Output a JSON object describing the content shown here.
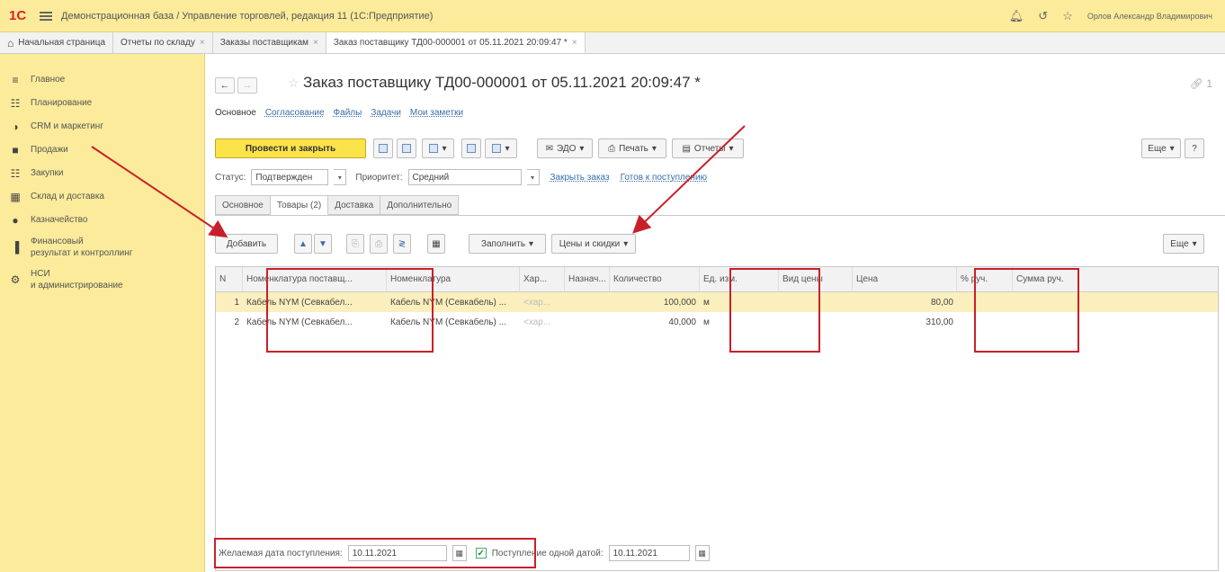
{
  "titlebar": {
    "logo": "1С",
    "title": "Демонстрационная база / Управление торговлей, редакция 11  (1С:Предприятие)",
    "user": "Орлов Александр Владимирович"
  },
  "tabs": [
    {
      "label": "Начальная страница"
    },
    {
      "label": "Отчеты по складу"
    },
    {
      "label": "Заказы поставщикам"
    },
    {
      "label": "Заказ поставщику ТД00-000001 от 05.11.2021 20:09:47 *"
    }
  ],
  "sidebar": {
    "items": [
      {
        "label": "Главное",
        "icon": "menu-icon"
      },
      {
        "label": "Планирование",
        "icon": "planning-icon"
      },
      {
        "label": "CRM и маркетинг",
        "icon": "crm-icon"
      },
      {
        "label": "Продажи",
        "icon": "sales-icon"
      },
      {
        "label": "Закупки",
        "icon": "cart-icon"
      },
      {
        "label": "Склад и доставка",
        "icon": "warehouse-icon"
      },
      {
        "label": "Казначейство",
        "icon": "treasury-icon"
      },
      {
        "label": "Финансовый",
        "label2": "результат и контроллинг",
        "icon": "chart-icon"
      },
      {
        "label": "НСИ",
        "label2": "и администрирование",
        "icon": "gear-icon"
      }
    ]
  },
  "document": {
    "title": "Заказ поставщику ТД00-000001 от 05.11.2021 20:09:47 *",
    "subtabs": [
      "Основное",
      "Согласование",
      "Файлы",
      "Задачи",
      "Мои заметки"
    ],
    "page_counter": "1"
  },
  "toolbar": {
    "post_close": "Провести и закрыть",
    "edo": "ЭДО",
    "print": "Печать",
    "reports": "Отчеты",
    "more": "Еще",
    "help": "?"
  },
  "status": {
    "status_label": "Статус:",
    "status_value": "Подтвержден",
    "priority_label": "Приоритет:",
    "priority_value": "Средний",
    "close_order": "Закрыть заказ",
    "ready": "Готов к поступлению"
  },
  "inner_tabs": [
    "Основное",
    "Товары (2)",
    "Доставка",
    "Дополнительно"
  ],
  "table_toolbar": {
    "add": "Добавить",
    "fill": "Заполнить",
    "prices": "Цены и скидки",
    "more": "Еще"
  },
  "table": {
    "headers": [
      "N",
      "Номенклатура поставщ...",
      "Номенклатура",
      "Хар...",
      "Назнач...",
      "Количество",
      "Ед. изм.",
      "Вид цены",
      "Цена",
      "% руч.",
      "Сумма руч."
    ],
    "rows": [
      {
        "n": "1",
        "supplier_item": "Кабель NYM (Севкабел...",
        "item": "Кабель NYM (Севкабель) ...",
        "char": "<хар...",
        "qty": "100,000",
        "unit": "м",
        "price": "80,00"
      },
      {
        "n": "2",
        "supplier_item": "Кабель NYM (Севкабел...",
        "item": "Кабель NYM (Севкабель) ...",
        "char": "<хар...",
        "qty": "40,000",
        "unit": "м",
        "price": "310,00"
      }
    ]
  },
  "footer": {
    "desired_label": "Желаемая дата поступления:",
    "desired_value": "10.11.2021",
    "one_date_label": "Поступление одной датой:",
    "one_date_value": "10.11.2021"
  },
  "colors": {
    "accent_yellow": "#fbeb9a",
    "primary_button": "#fbe34a",
    "annotation_red": "#c8202a",
    "selected_row": "#fbefbd"
  }
}
